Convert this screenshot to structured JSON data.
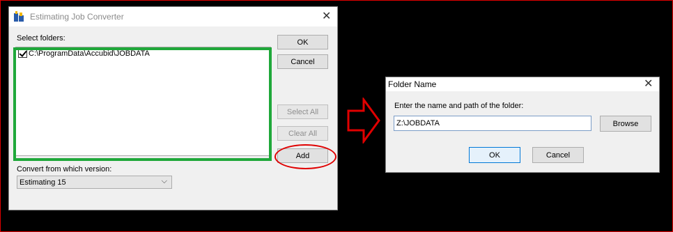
{
  "converter": {
    "title": "Estimating Job Converter",
    "select_folders_label": "Select folders:",
    "folders": [
      {
        "path": "C:\\ProgramData\\Accubid\\JOBDATA",
        "checked": true
      }
    ],
    "buttons": {
      "ok": "OK",
      "cancel": "Cancel",
      "select_all": "Select All",
      "clear_all": "Clear All",
      "add": "Add"
    },
    "version_label": "Convert from which version:",
    "version_selected": "Estimating 15"
  },
  "folder_dialog": {
    "title": "Folder Name",
    "prompt": "Enter the name and path of the folder:",
    "path_value": "Z:\\JOBDATA",
    "buttons": {
      "browse": "Browse",
      "ok": "OK",
      "cancel": "Cancel"
    }
  },
  "annotations": {
    "frame_color": "#e00000",
    "highlight_list_color": "#1fa83a",
    "highlight_add_color": "#e00000",
    "arrow_color": "#e00000"
  }
}
